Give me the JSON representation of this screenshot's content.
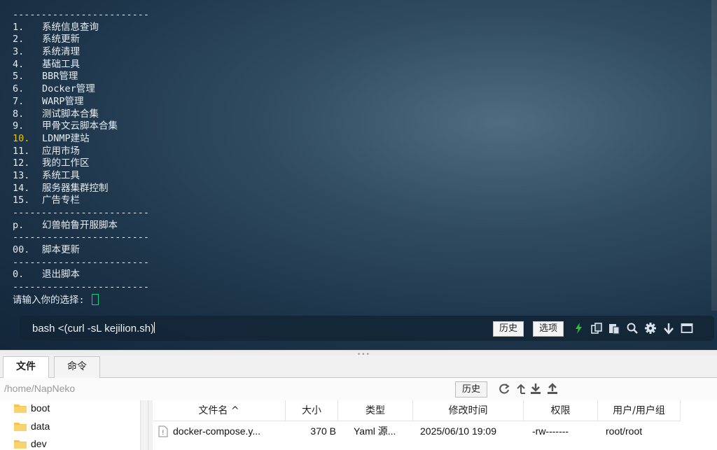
{
  "terminal": {
    "separator": "------------------------",
    "menu": [
      {
        "num": "1.",
        "label": "系统信息查询"
      },
      {
        "num": "2.",
        "label": "系统更新"
      },
      {
        "num": "3.",
        "label": "系统清理"
      },
      {
        "num": "4.",
        "label": "基础工具"
      },
      {
        "num": "5.",
        "label": "BBR管理"
      },
      {
        "num": "6.",
        "label": "Docker管理"
      },
      {
        "num": "7.",
        "label": "WARP管理"
      },
      {
        "num": "8.",
        "label": "测试脚本合集"
      },
      {
        "num": "9.",
        "label": "甲骨文云脚本合集"
      },
      {
        "num": "10.",
        "label": "LDNMP建站"
      },
      {
        "num": "11.",
        "label": "应用市场"
      },
      {
        "num": "12.",
        "label": "我的工作区"
      },
      {
        "num": "13.",
        "label": "系统工具"
      },
      {
        "num": "14.",
        "label": "服务器集群控制"
      },
      {
        "num": "15.",
        "label": "广告专栏"
      }
    ],
    "extra_p": {
      "num": "p.",
      "label": "幻兽帕鲁开服脚本"
    },
    "extra_00": {
      "num": "00.",
      "label": "脚本更新"
    },
    "extra_0": {
      "num": "0.",
      "label": "退出脚本"
    },
    "prompt": "请输入你的选择: "
  },
  "cmdbar": {
    "command": "bash <(curl -sL kejilion.sh)",
    "history_label": "历史",
    "options_label": "选项"
  },
  "tabs": {
    "files": "文件",
    "commands": "命令"
  },
  "pathbar": {
    "path": "/home/NapNeko",
    "history_label": "历史"
  },
  "tree": {
    "items": [
      "boot",
      "data",
      "dev"
    ]
  },
  "filetable": {
    "headers": {
      "name": "文件名 ^",
      "size": "大小",
      "type": "类型",
      "mtime": "修改时间",
      "perm": "权限",
      "owner": "用户/用户组"
    },
    "rows": [
      {
        "name": "docker-compose.y...",
        "size": "370 B",
        "type": "Yaml 源...",
        "mtime": "2025/06/10 19:09",
        "perm": "-rw-------",
        "owner": "root/root"
      }
    ]
  },
  "colors": {
    "highlight_num": "#f2c200",
    "cursor": "#18d07a",
    "lightning": "#2fc22f"
  }
}
